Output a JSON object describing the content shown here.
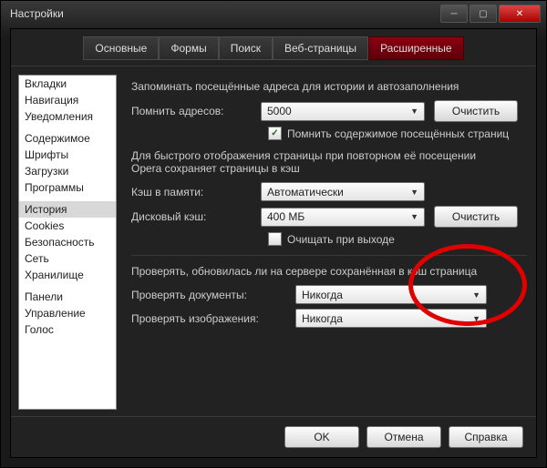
{
  "window": {
    "title": "Настройки"
  },
  "tabs": [
    "Основные",
    "Формы",
    "Поиск",
    "Веб-страницы",
    "Расширенные"
  ],
  "activeTab": 4,
  "sidebar": {
    "groups": [
      [
        "Вкладки",
        "Навигация",
        "Уведомления"
      ],
      [
        "Содержимое",
        "Шрифты",
        "Загрузки",
        "Программы"
      ],
      [
        "История",
        "Cookies",
        "Безопасность",
        "Сеть",
        "Хранилище"
      ],
      [
        "Панели",
        "Управление",
        "Голос"
      ]
    ],
    "active": "История"
  },
  "history": {
    "intro": "Запоминать посещённые адреса для истории и автозаполнения",
    "rememberLabel": "Помнить адресов:",
    "rememberValue": "5000",
    "clear": "Очистить",
    "rememberContent": "Помнить содержимое посещённых страниц",
    "cacheIntro1": "Для быстрого отображения страницы при повторном её посещении",
    "cacheIntro2": "Opera сохраняет страницы в кэш",
    "memCacheLabel": "Кэш в памяти:",
    "memCacheValue": "Автоматически",
    "diskCacheLabel": "Дисковый кэш:",
    "diskCacheValue": "400 МБ",
    "clear2": "Очистить",
    "clearOnExit": "Очищать при выходе",
    "checkIntro": "Проверять, обновилась ли на сервере сохранённая в кэш страница",
    "checkDocsLabel": "Проверять документы:",
    "checkDocsValue": "Никогда",
    "checkImgsLabel": "Проверять изображения:",
    "checkImgsValue": "Никогда"
  },
  "footer": {
    "ok": "OK",
    "cancel": "Отмена",
    "help": "Справка"
  }
}
